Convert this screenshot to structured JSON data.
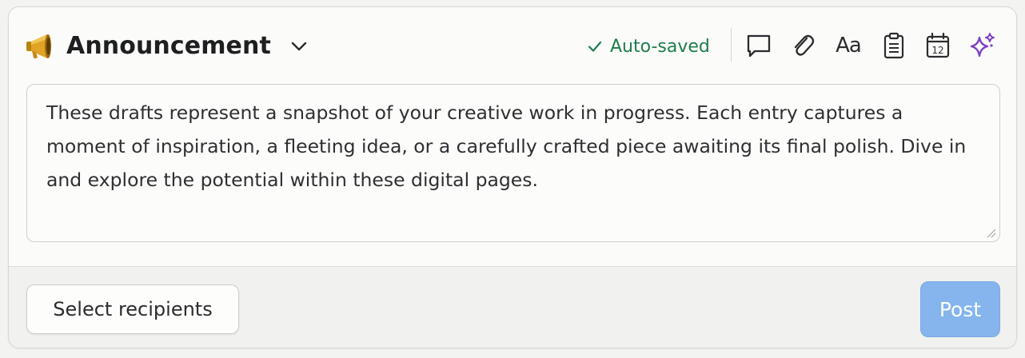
{
  "composer": {
    "title": "Announcement",
    "title_icon": "megaphone-icon",
    "autosave_status": "Auto-saved",
    "toolbar": {
      "tools": [
        "comment-icon",
        "attachment-icon",
        "text-format-icon",
        "clipboard-icon",
        "calendar-icon",
        "ai-sparkle-icon"
      ],
      "text_format_label": "Aa",
      "calendar_day": "12"
    },
    "body_text": "These drafts represent a snapshot of your creative work in progress. Each entry captures a moment of inspiration, a fleeting idea, or a carefully crafted piece awaiting its final polish. Dive in and explore the potential within these digital pages.",
    "select_recipients_label": "Select recipients",
    "post_label": "Post"
  },
  "colors": {
    "autosave_green": "#1e7d4c",
    "post_button_disabled_blue": "#85b5ec",
    "sparkle_purple": "#7b3fc4"
  }
}
